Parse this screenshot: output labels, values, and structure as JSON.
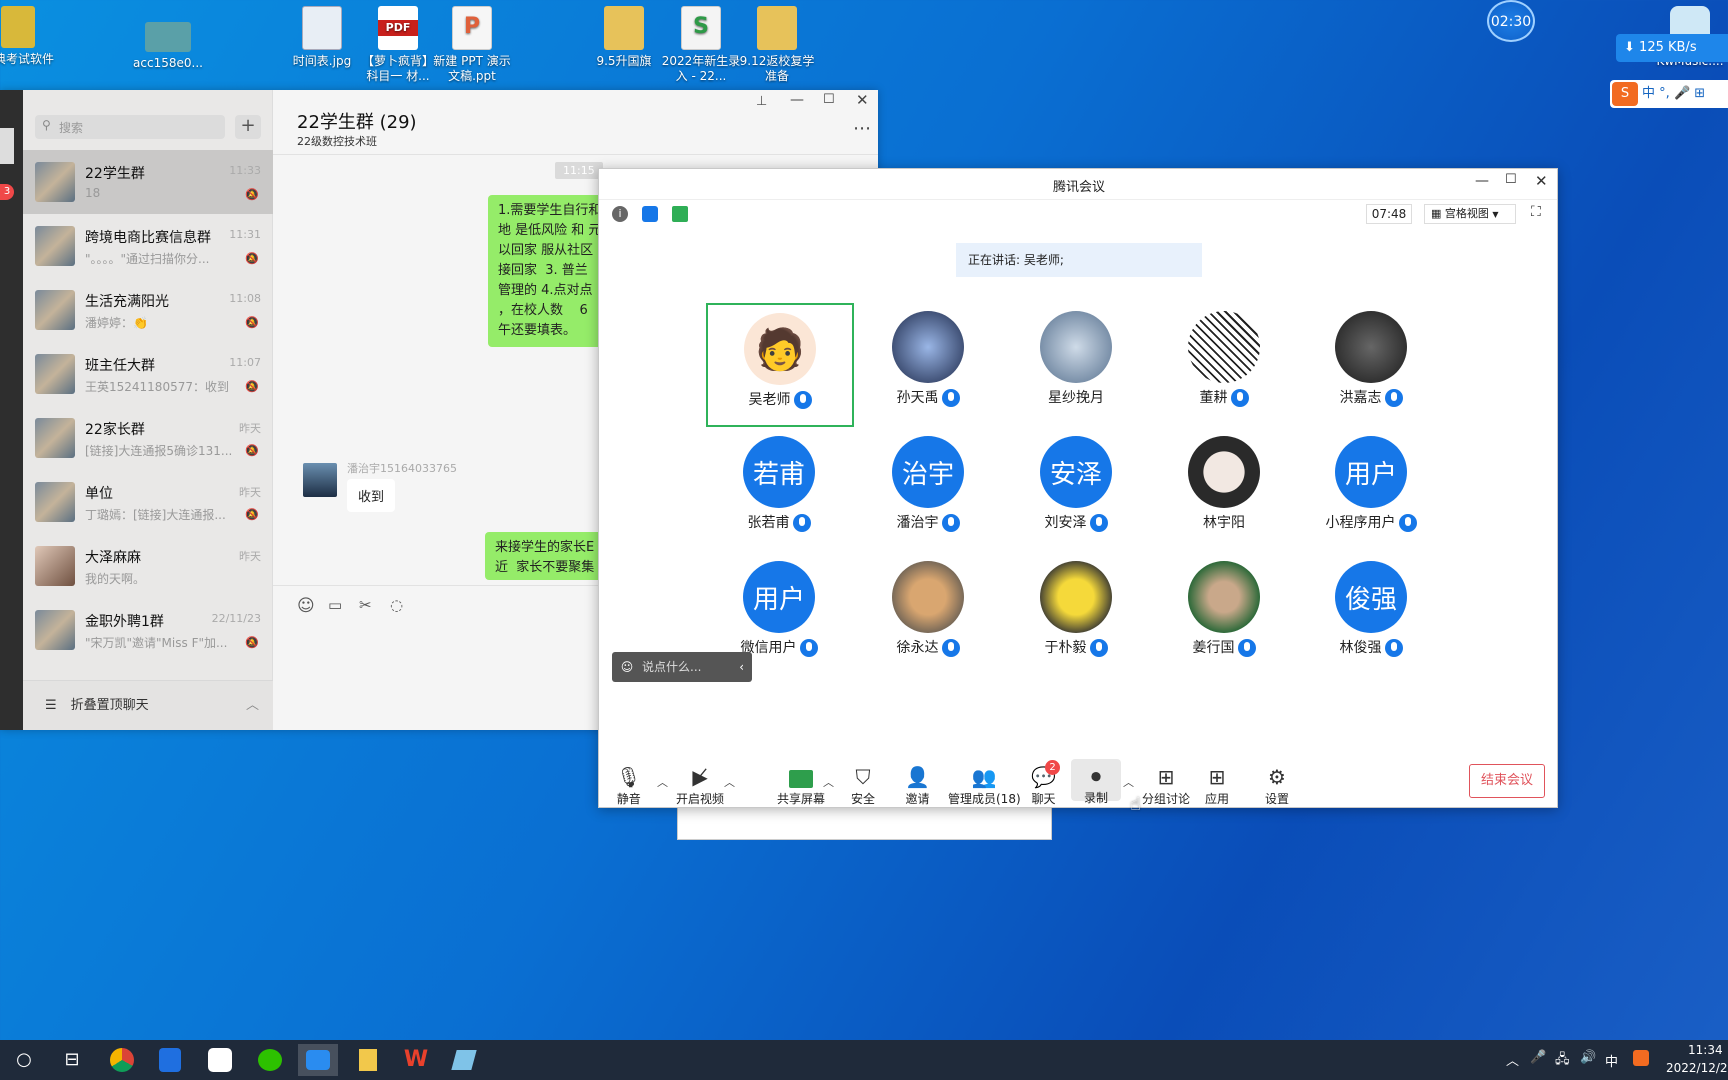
{
  "desktop": {
    "icons": [
      {
        "label": "考典考试软件",
        "color": "#d8b83a"
      },
      {
        "label": "acc158e0...",
        "color": "#5aa0a8"
      },
      {
        "label": "时间表.jpg",
        "color": "#e8eef5"
      },
      {
        "label": "【萝卜疯背】科目一 材...",
        "color": "#c8201c",
        "badge": "PDF"
      },
      {
        "label": "新建 PPT 演示文稿.ppt",
        "color": "#f0f0f0"
      },
      {
        "label": "9.5升国旗",
        "color": "#e7c25a"
      },
      {
        "label": "2022年新生录入 - 22...",
        "color": "#f4f4f4"
      },
      {
        "label": "9.12返校复学准备",
        "color": "#e7c25a"
      },
      {
        "label": "KwMusic....",
        "color": "#cfe8f6"
      }
    ],
    "clock_widget": "02:30",
    "net_speed": "125 KB/s",
    "ime_items": [
      "中",
      "°,",
      "🎤",
      "⊞"
    ]
  },
  "wechat": {
    "search_placeholder": "搜索",
    "add_label": "+",
    "rail_badge": "3",
    "chats": [
      {
        "name": "22学生群",
        "time": "11:33",
        "preview": "18",
        "muted": true,
        "active": true
      },
      {
        "name": "跨境电商比赛信息群",
        "time": "11:31",
        "preview": "\"。。。。\"通过扫描你分...",
        "muted": true
      },
      {
        "name": "生活充满阳光",
        "time": "11:08",
        "preview": "潘婷婷：👏",
        "muted": true
      },
      {
        "name": "班主任大群",
        "time": "11:07",
        "preview": "王英15241180577：收到",
        "muted": true
      },
      {
        "name": "22家长群",
        "time": "昨天",
        "preview": "[链接]大连通报5确诊131...",
        "muted": true
      },
      {
        "name": "单位",
        "time": "昨天",
        "preview": "丁璐嫣：[链接]大连通报...",
        "muted": true
      },
      {
        "name": "大泽麻麻",
        "time": "昨天",
        "preview": "我的天啊。",
        "muted": false
      },
      {
        "name": "金职外聘1群",
        "time": "22/11/23",
        "preview": "\"宋万凯\"邀请\"Miss F\"加...",
        "muted": true
      }
    ],
    "folded_label": "折叠置顶聊天",
    "chat_title": "22学生群 (29)",
    "chat_subtitle": "22级数控技术班",
    "timestamp": "11:15",
    "messages": {
      "bubble1": "1.需要学生自行和\n地 是低风险 和 元\n以回家 服从社区\n接回家  3. 普兰\n管理的 4.点对点\n，在校人数    6\n午还要填表。",
      "sender": "潘治宇15164033765",
      "reply": "收到",
      "bubble2": "来接学生的家长E\n近  家长不要聚集"
    }
  },
  "meeting": {
    "title": "腾讯会议",
    "timer": "07:48",
    "view_label": "宫格视图",
    "speaking": "正在讲话: 吴老师;",
    "participants": [
      {
        "name": "吴老师",
        "initials": "",
        "style": "cartoon",
        "active": true
      },
      {
        "name": "孙天禹",
        "initials": "",
        "style": "dark"
      },
      {
        "name": "星纱挽月",
        "initials": "",
        "style": "blue-gray"
      },
      {
        "name": "董耕",
        "initials": "",
        "style": "sketch"
      },
      {
        "name": "洪嘉志",
        "initials": "",
        "style": "dark-gray"
      },
      {
        "name": "张若甫",
        "initials": "若甫",
        "style": "blue"
      },
      {
        "name": "潘治宇",
        "initials": "治宇",
        "style": "blue"
      },
      {
        "name": "刘安泽",
        "initials": "安泽",
        "style": "blue"
      },
      {
        "name": "林宇阳",
        "initials": "",
        "style": "anime"
      },
      {
        "name": "小程序用户",
        "initials": "用户",
        "style": "blue"
      },
      {
        "name": "微信用户",
        "initials": "用户",
        "style": "blue"
      },
      {
        "name": "徐永达",
        "initials": "",
        "style": "dog"
      },
      {
        "name": "于朴毅",
        "initials": "",
        "style": "yellow"
      },
      {
        "name": "姜行国",
        "initials": "",
        "style": "green"
      },
      {
        "name": "林俊强",
        "initials": "俊强",
        "style": "blue"
      }
    ],
    "chat_input_placeholder": "说点什么...",
    "toolbar": [
      {
        "label": "静音",
        "icon": "mic-icon"
      },
      {
        "label": "开启视频",
        "icon": "video-off-icon"
      },
      {
        "label": "共享屏幕",
        "icon": "share-screen-icon"
      },
      {
        "label": "安全",
        "icon": "shield-icon"
      },
      {
        "label": "邀请",
        "icon": "invite-icon"
      },
      {
        "label": "管理成员(18)",
        "icon": "members-icon"
      },
      {
        "label": "聊天",
        "icon": "chat-icon",
        "badge": "2"
      },
      {
        "label": "录制",
        "icon": "record-icon"
      },
      {
        "label": "分组讨论",
        "icon": "breakout-icon"
      },
      {
        "label": "应用",
        "icon": "apps-icon"
      },
      {
        "label": "设置",
        "icon": "gear-icon"
      }
    ],
    "end_label": "结束会议"
  },
  "taskbar": {
    "time": "11:34",
    "date": "2022/12/2",
    "ime": "中"
  }
}
